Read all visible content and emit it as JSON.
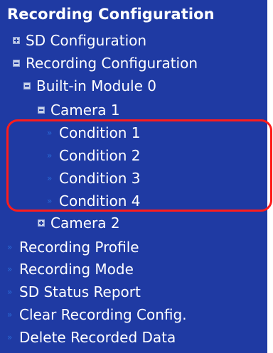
{
  "title": "Recording Configuration",
  "icons": {
    "plus": "plus-square-icon",
    "minus": "minus-square-icon",
    "chevron": "double-chevron-right-icon"
  },
  "items": [
    {
      "label": "SD Configuration",
      "toggle": "plus"
    },
    {
      "label": "Recording Configuration",
      "toggle": "minus"
    },
    {
      "label": "Built-in Module 0",
      "toggle": "minus"
    },
    {
      "label": "Camera 1",
      "toggle": "minus"
    },
    {
      "label": "Condition 1",
      "toggle": "chevron"
    },
    {
      "label": "Condition 2",
      "toggle": "chevron"
    },
    {
      "label": "Condition 3",
      "toggle": "chevron"
    },
    {
      "label": "Condition 4",
      "toggle": "chevron"
    },
    {
      "label": "Camera 2",
      "toggle": "plus"
    },
    {
      "label": "Recording Profile",
      "toggle": "chevron"
    },
    {
      "label": "Recording Mode",
      "toggle": "chevron"
    },
    {
      "label": "SD Status Report",
      "toggle": "chevron"
    },
    {
      "label": "Clear Recording Config.",
      "toggle": "chevron"
    },
    {
      "label": "Delete Recorded Data",
      "toggle": "chevron"
    }
  ]
}
